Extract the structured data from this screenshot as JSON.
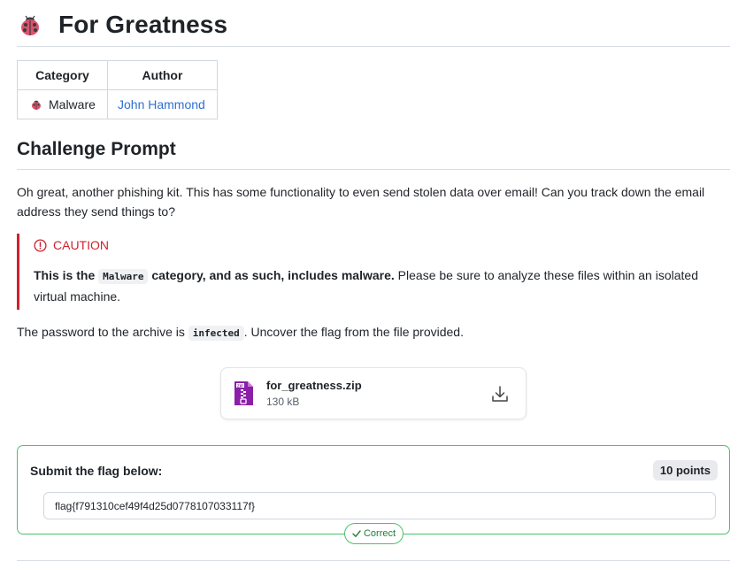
{
  "challenge": {
    "title": "For Greatness",
    "icon": "ladybug-icon"
  },
  "meta": {
    "headers": [
      "Category",
      "Author"
    ],
    "category": "Malware",
    "category_icon": "ladybug-icon",
    "author": "John Hammond"
  },
  "prompt": {
    "heading": "Challenge Prompt",
    "text": "Oh great, another phishing kit. This has some functionality to even send stolen data over email! Can you track down the email address they send things to?"
  },
  "caution": {
    "label": "CAUTION",
    "bold_prefix": "This is the ",
    "code": "Malware",
    "bold_suffix": " category, and as such, includes malware.",
    "rest": " Please be sure to analyze these files within an isolated virtual machine."
  },
  "password": {
    "prefix": "The password to the archive is ",
    "code": "infected",
    "suffix": ". Uncover the flag from the file provided."
  },
  "file": {
    "name": "for_greatness.zip",
    "size": "130 kB",
    "icon": "zip-file-icon"
  },
  "flag": {
    "label": "Submit the flag below:",
    "points": "10 points",
    "value": "flag{f791310cef49f4d25d0778107033117f}",
    "status": "Correct"
  },
  "colors": {
    "accent_link": "#2f6fd0",
    "caution": "#cf222e",
    "success": "#1a7f37",
    "success_border": "#4ac26b",
    "zip_purple": "#8b1fa9"
  }
}
